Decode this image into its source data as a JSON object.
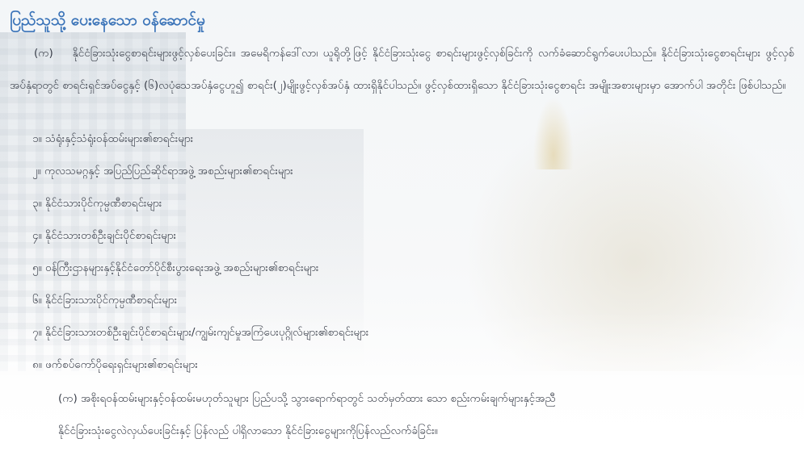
{
  "page": {
    "title": "ပြည်သူသို့ ပေးနေသော ဝန်ဆောင်မှု"
  },
  "intro": {
    "label": "(က)",
    "text": "နိုင်ငံခြားသုံးငွေစာရင်းများဖွင့်လှစ်ပေးခြင်း။ အမေရိကန်ဒေါ်လာ၊ ယူရိုတို့ဖြင့် နိုင်ငံခြားသုံးငွေ စာရင်းများဖွင့်လှစ်ခြင်းကို လက်ခံဆောင်ရွက်ပေးပါသည်။ နိုင်ငံခြားသုံးငွေစာရင်းများ ဖွင့်လှစ် အပ်နှံရာတွင် စာရင်းရှင်အပ်ငွေနှင့် (၆)လပုံသေအပ်နှံငွေဟူ၍ စာရင်း(၂)မျိုးဖွင့်လှစ်အပ်နှံ ထားရှိနိုင်ပါသည်။ ဖွင့်လှစ်ထားရှိသော နိုင်ငံခြားသုံးငွေစာရင်း အမျိုးအစားများမှာ အောက်ပါ အတိုင်း ဖြစ်ပါသည်။"
  },
  "list": [
    "၁။ သံရုံးနှင့်သံရုံးဝန်ထမ်းများ၏စာရင်းများ",
    "၂။ ကုလသမဂ္ဂနှင့် အပြည်ပြည်ဆိုင်ရာအဖွဲ့ အစည်းများ၏စာရင်းများ",
    "၃။ နိုင်ငံသားပိုင်ကုမ္ပဏီစာရင်းများ",
    "၄။ နိုင်ငံသားတစ်ဦးချင်းပိုင်စာရင်းများ",
    "၅။ ဝန်ကြီးဌာနများနှင့်နိုင်ငံတော်ပိုင်စီးပွားရေးအဖွဲ့ အစည်းများ၏စာရင်းများ",
    "၆။ နိုင်ငံခြားသားပိုင်ကုမ္ပဏီစာရင်းများ",
    "၇။ နိုင်ငံခြားသားတစ်ဦးချင်းပိုင်စာရင်းများ/ကျွမ်းကျင်မှုအကြံပေးပုဂ္ဂိုလ်များ၏စာရင်းများ",
    "၈။ ဖက်စပ်ကော်ပိုရေးရှင်းများ၏စာရင်းများ"
  ],
  "sub": {
    "line1": "(က) အစိုးရဝန်ထမ်းများနှင့်ဝန်ထမ်းမဟုတ်သူများ ပြည်ပသို့ သွားရောက်ရာတွင် သတ်မှတ်ထား သော စည်းကမ်းချက်များနှင့်အညီ",
    "line2": "နိုင်ငံခြားသုံးငွေလဲလှယ်ပေးခြင်းနှင့် ပြန်လည် ပါရှိလာသော နိုင်ငံခြားငွေများကိုပြန်လည်လက်ခံခြင်း။"
  }
}
